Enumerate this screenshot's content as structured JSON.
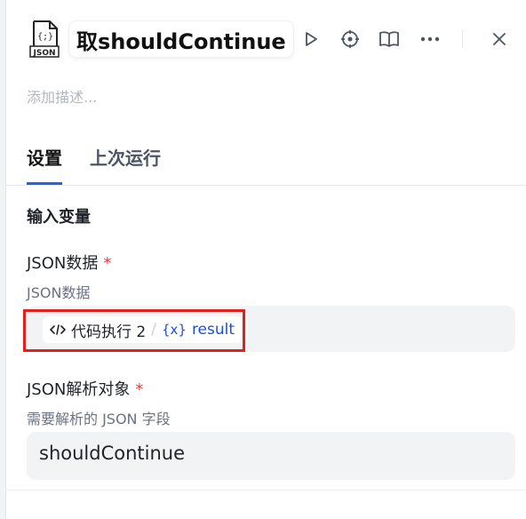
{
  "header": {
    "node_icon_label": "JSON",
    "title": "取shouldContinue",
    "buttons": [
      "run-icon",
      "locate-icon",
      "docs-icon",
      "more-icon",
      "close-icon"
    ]
  },
  "description_placeholder": "添加描述...",
  "tabs": [
    {
      "label": "设置",
      "active": true
    },
    {
      "label": "上次运行",
      "active": false
    }
  ],
  "inputs_section": {
    "title": "输入变量",
    "fields": [
      {
        "label": "JSON数据",
        "required_mark": "*",
        "description": "JSON数据",
        "reference": {
          "source": "代码执行 2",
          "separator": "/",
          "variable_icon": "{x}",
          "variable": "result"
        }
      },
      {
        "label": "JSON解析对象",
        "required_mark": "*",
        "description": "需要解析的 JSON 字段",
        "value": "shouldContinue"
      }
    ]
  },
  "colors": {
    "accent": "#2563eb",
    "required": "#e03c3c",
    "highlight": "#e5201c",
    "variable": "#1d4ed8"
  }
}
